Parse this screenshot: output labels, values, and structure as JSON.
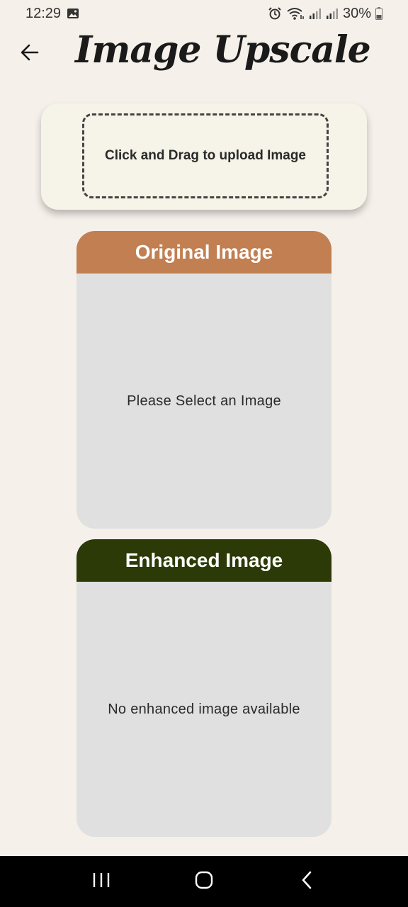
{
  "status_bar": {
    "time": "12:29",
    "battery": "30%",
    "icons": [
      "gallery-icon",
      "alarm-icon",
      "wifi-icon",
      "signal-icon",
      "signal-icon",
      "battery-icon"
    ]
  },
  "app_bar": {
    "title": "Image Upscale",
    "back_icon": "arrow-left-icon"
  },
  "upload": {
    "label": "Click and Drag to upload Image"
  },
  "original_panel": {
    "title": "Original Image",
    "placeholder": "Please Select an Image",
    "header_color": "#c17f52"
  },
  "enhanced_panel": {
    "title": "Enhanced Image",
    "placeholder": "No enhanced image available",
    "header_color": "#2b3a06"
  },
  "nav_bar": {
    "buttons": [
      "recents-icon",
      "home-icon",
      "back-icon"
    ]
  },
  "colors": {
    "background": "#f5f0ea",
    "panel_body": "#e0e0e0",
    "upload_card": "#f6f3e9"
  }
}
